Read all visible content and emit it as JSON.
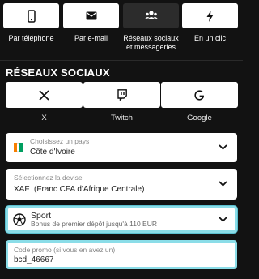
{
  "tabs": [
    {
      "label": "Par téléphone",
      "icon": "phone-icon"
    },
    {
      "label": "Par e-mail",
      "icon": "envelope-icon"
    },
    {
      "label": "Réseaux sociaux et messageries",
      "icon": "users-icon"
    },
    {
      "label": "En un clic",
      "icon": "lightning-icon"
    }
  ],
  "section_title": "RÉSEAUX SOCIAUX",
  "social": [
    {
      "label": "X",
      "icon": "x-logo-icon"
    },
    {
      "label": "Twitch",
      "icon": "twitch-logo-icon"
    },
    {
      "label": "Google",
      "icon": "google-logo-icon"
    }
  ],
  "country": {
    "label": "Choisissez un pays",
    "value": "Côte d'Ivoire"
  },
  "currency": {
    "label": "Sélectionnez la devise",
    "value": "XAF  (Franc CFA d'Afrique Centrale)"
  },
  "bonus": {
    "title": "Sport",
    "subtitle": "Bonus de premier dépôt jusqu'à 110 EUR"
  },
  "promo": {
    "label": "Code promo (si vous en avez un)",
    "value": "bcd_46667"
  },
  "colors": {
    "background": "#121212",
    "highlight": "#8bdde8",
    "flag": [
      "#f77f00",
      "#ffffff",
      "#009e60"
    ]
  }
}
